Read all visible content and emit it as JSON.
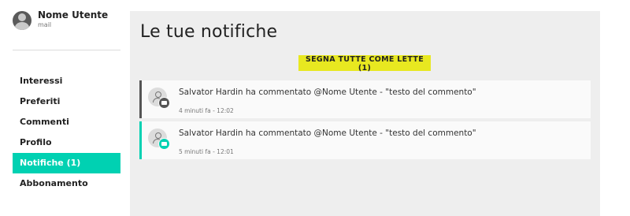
{
  "user": {
    "name": "Nome Utente",
    "mail": "mail"
  },
  "nav": {
    "items": [
      {
        "label": "Interessi"
      },
      {
        "label": "Preferiti"
      },
      {
        "label": "Commenti"
      },
      {
        "label": "Profilo"
      },
      {
        "label": "Notifiche (1)",
        "active": true
      },
      {
        "label": "Abbonamento"
      }
    ]
  },
  "main": {
    "title": "Le tue notifiche",
    "mark_all_label": "SEGNA TUTTE COME LETTE (1)"
  },
  "notifications": [
    {
      "text": "Salvator Hardin ha commentato @Nome Utente - \"testo del commento\"",
      "time": "4 minuti fa - 12:02",
      "unread": false
    },
    {
      "text": "Salvator Hardin ha commentato @Nome Utente - \"testo del commento\"",
      "time": "5 minuti fa - 12:01",
      "unread": true
    }
  ],
  "colors": {
    "accent": "#00d1b2",
    "button": "#e8e820",
    "read_border": "#555555"
  },
  "icons": {
    "user_avatar": "user-avatar-icon",
    "notif_avatar": "person-icon",
    "notif_badge": "comment-bubble-icon"
  }
}
